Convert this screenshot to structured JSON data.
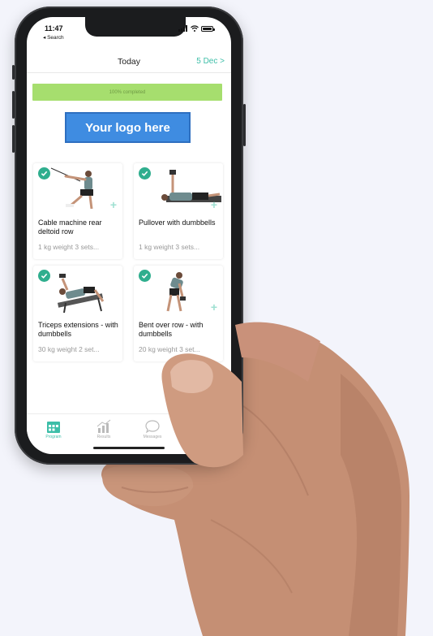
{
  "status_bar": {
    "time": "11:47",
    "back_label": "◂ Search"
  },
  "nav": {
    "title": "Today",
    "date_link": "5 Dec >"
  },
  "progress": {
    "label": "100% completed",
    "fraction": 1.0,
    "color": "#a6de6e"
  },
  "logo": {
    "text": "Your logo here",
    "color": "#3f8ce1"
  },
  "accent_color": "#3dbea8",
  "exercises": [
    {
      "name": "Cable machine rear deltoid row",
      "meta": "1 kg weight 3 sets...",
      "completed": true,
      "icon": "check-icon"
    },
    {
      "name": "Pullover with dumbbells",
      "meta": "1 kg weight 3 sets...",
      "completed": true,
      "icon": "check-icon"
    },
    {
      "name": "Triceps extensions - with dumbbells",
      "meta": "30 kg weight 2 set...",
      "completed": true,
      "icon": "check-icon"
    },
    {
      "name": "Bent over row - with dumbbells",
      "meta": "20 kg weight 3 set...",
      "completed": true,
      "icon": "check-icon"
    }
  ],
  "tabs": [
    {
      "label": "Program",
      "icon": "calendar-icon",
      "active": true
    },
    {
      "label": "Results",
      "icon": "chart-icon",
      "active": false
    },
    {
      "label": "Messages",
      "icon": "chat-bubble-icon",
      "active": false
    }
  ]
}
